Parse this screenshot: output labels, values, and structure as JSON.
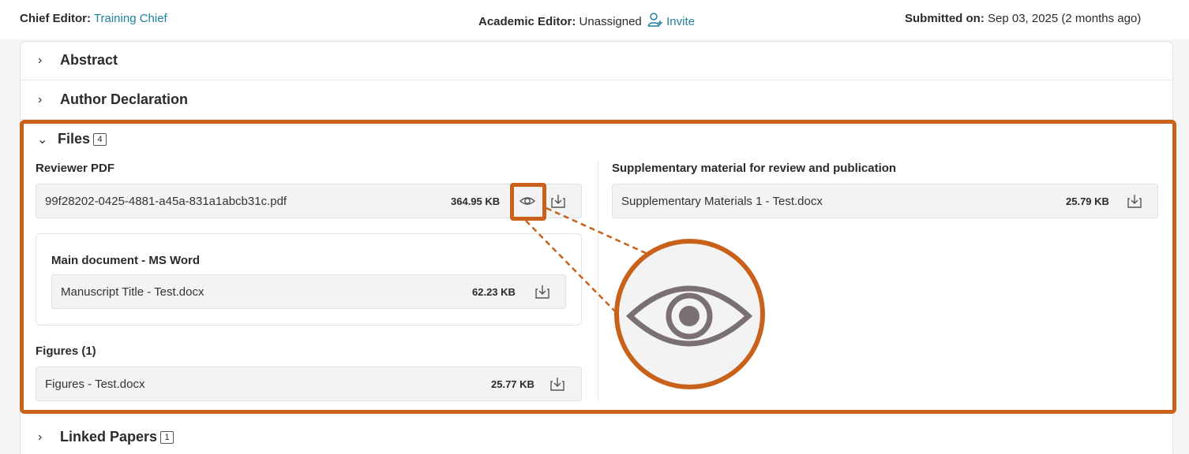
{
  "topbar": {
    "chief_editor_label": "Chief Editor:",
    "chief_editor_name": "Training Chief",
    "academic_editor_label": "Academic Editor:",
    "academic_editor_value": "Unassigned",
    "invite_label": "Invite",
    "submitted_label": "Submitted on:",
    "submitted_value": "Sep 03, 2025 (2 months ago)"
  },
  "sections": {
    "abstract": "Abstract",
    "author_declaration": "Author Declaration",
    "files": "Files",
    "files_count": "4",
    "linked_papers": "Linked Papers",
    "linked_papers_count": "1"
  },
  "files": {
    "reviewer_pdf": {
      "label": "Reviewer PDF",
      "name": "99f28202-0425-4881-a45a-831a1abcb31c.pdf",
      "size": "364.95 KB"
    },
    "main_document": {
      "label": "Main document - MS Word",
      "name": "Manuscript Title - Test.docx",
      "size": "62.23 KB"
    },
    "figures": {
      "label": "Figures (1)",
      "name": "Figures - Test.docx",
      "size": "25.77 KB"
    },
    "supplementary": {
      "label": "Supplementary material for review and publication",
      "name": "Supplementary Materials 1 - Test.docx",
      "size": "25.79 KB"
    }
  },
  "icons": {
    "view": "eye-icon",
    "download": "download-icon",
    "invite": "add-user-icon",
    "collapsed": "chevron-right-icon",
    "expanded": "chevron-down-icon"
  },
  "colors": {
    "accent_link": "#1f7fa0",
    "annotation": "#c8611a",
    "icon_gray": "#7a7072"
  }
}
